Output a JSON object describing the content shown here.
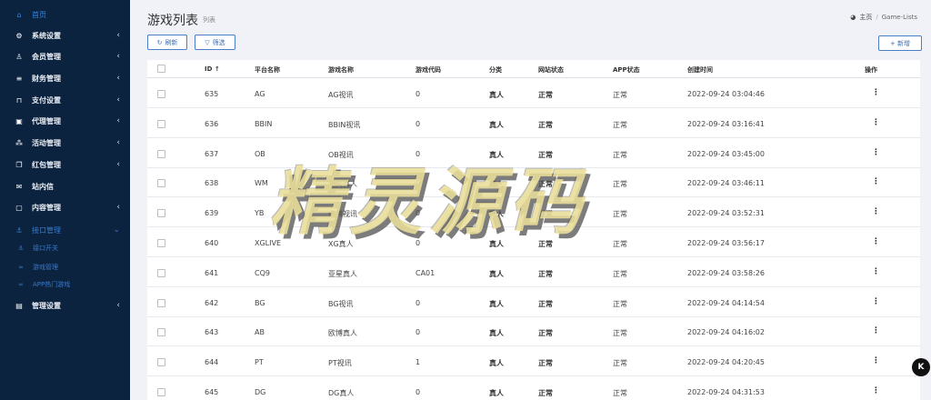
{
  "sidebar": {
    "items": [
      {
        "label": "首页",
        "icon": "home-icon",
        "glyph": "⌂"
      },
      {
        "label": "系统设置",
        "icon": "cogs-icon",
        "glyph": "⚙"
      },
      {
        "label": "会员管理",
        "icon": "user-icon",
        "glyph": "♙"
      },
      {
        "label": "财务管理",
        "icon": "database-icon",
        "glyph": "≡"
      },
      {
        "label": "支付设置",
        "icon": "bookmark-icon",
        "glyph": "⊓"
      },
      {
        "label": "代理管理",
        "icon": "id-card-icon",
        "glyph": "▣"
      },
      {
        "label": "活动管理",
        "icon": "network-icon",
        "glyph": "⁂"
      },
      {
        "label": "红包管理",
        "icon": "clone-icon",
        "glyph": "❐"
      },
      {
        "label": "站内信",
        "icon": "envelope-icon",
        "glyph": "✉"
      },
      {
        "label": "内容管理",
        "icon": "copy-icon",
        "glyph": "▢"
      },
      {
        "label": "接口管理",
        "icon": "anchor-icon",
        "glyph": "⚓"
      },
      {
        "label": "管理设置",
        "icon": "address-card-icon",
        "glyph": "▤"
      }
    ],
    "sub_items": [
      {
        "label": "接口开关",
        "icon": "anchor-icon",
        "glyph": "⚓"
      },
      {
        "label": "游戏管理",
        "icon": "link-icon",
        "glyph": "∞"
      },
      {
        "label": "APP热门游戏",
        "icon": "link-icon",
        "glyph": "∞"
      }
    ],
    "colors": {
      "background": "#0c2340",
      "active": "#2f86e6",
      "expanded": "#3a78c8"
    }
  },
  "header": {
    "title": "游戏列表",
    "subtitle": "列表",
    "breadcrumb": {
      "home": "主页",
      "separator": "/",
      "current": "Game-Lists"
    }
  },
  "toolbar": {
    "refresh": "刷新",
    "filter": "筛选",
    "add": "+ 新增"
  },
  "table": {
    "columns": [
      "ID ↑",
      "平台名称",
      "游戏名称",
      "游戏代码",
      "分类",
      "网站状态",
      "APP状态",
      "创建时间",
      "操作"
    ],
    "rows": [
      {
        "id": "635",
        "platform": "AG",
        "game": "AG视讯",
        "code": "0",
        "category": "真人",
        "site_status": "正常",
        "app_status": "正常",
        "created": "2022-09-24 03:04:46"
      },
      {
        "id": "636",
        "platform": "BBIN",
        "game": "BBIN视讯",
        "code": "0",
        "category": "真人",
        "site_status": "正常",
        "app_status": "正常",
        "created": "2022-09-24 03:16:41"
      },
      {
        "id": "637",
        "platform": "OB",
        "game": "OB视讯",
        "code": "0",
        "category": "真人",
        "site_status": "正常",
        "app_status": "正常",
        "created": "2022-09-24 03:45:00"
      },
      {
        "id": "638",
        "platform": "WM",
        "game": "完美真人",
        "code": "0",
        "category": "真人",
        "site_status": "正常",
        "app_status": "正常",
        "created": "2022-09-24 03:46:11"
      },
      {
        "id": "639",
        "platform": "YB",
        "game": "亿博视讯",
        "code": "0",
        "category": "真人",
        "site_status": "正常",
        "app_status": "正常",
        "created": "2022-09-24 03:52:31"
      },
      {
        "id": "640",
        "platform": "XGLIVE",
        "game": "XG真人",
        "code": "0",
        "category": "真人",
        "site_status": "正常",
        "app_status": "正常",
        "created": "2022-09-24 03:56:17"
      },
      {
        "id": "641",
        "platform": "CQ9",
        "game": "亚星真人",
        "code": "CA01",
        "category": "真人",
        "site_status": "正常",
        "app_status": "正常",
        "created": "2022-09-24 03:58:26"
      },
      {
        "id": "642",
        "platform": "BG",
        "game": "BG视讯",
        "code": "0",
        "category": "真人",
        "site_status": "正常",
        "app_status": "正常",
        "created": "2022-09-24 04:14:54"
      },
      {
        "id": "643",
        "platform": "AB",
        "game": "欧博真人",
        "code": "0",
        "category": "真人",
        "site_status": "正常",
        "app_status": "正常",
        "created": "2022-09-24 04:16:02"
      },
      {
        "id": "644",
        "platform": "PT",
        "game": "PT视讯",
        "code": "1",
        "category": "真人",
        "site_status": "正常",
        "app_status": "正常",
        "created": "2022-09-24 04:20:45"
      },
      {
        "id": "645",
        "platform": "DG",
        "game": "DG真人",
        "code": "0",
        "category": "真人",
        "site_status": "正常",
        "app_status": "正常",
        "created": "2022-09-24 04:31:53"
      }
    ],
    "action_glyph": "⋮"
  },
  "watermark": "精灵源码",
  "corner_badge": "K"
}
